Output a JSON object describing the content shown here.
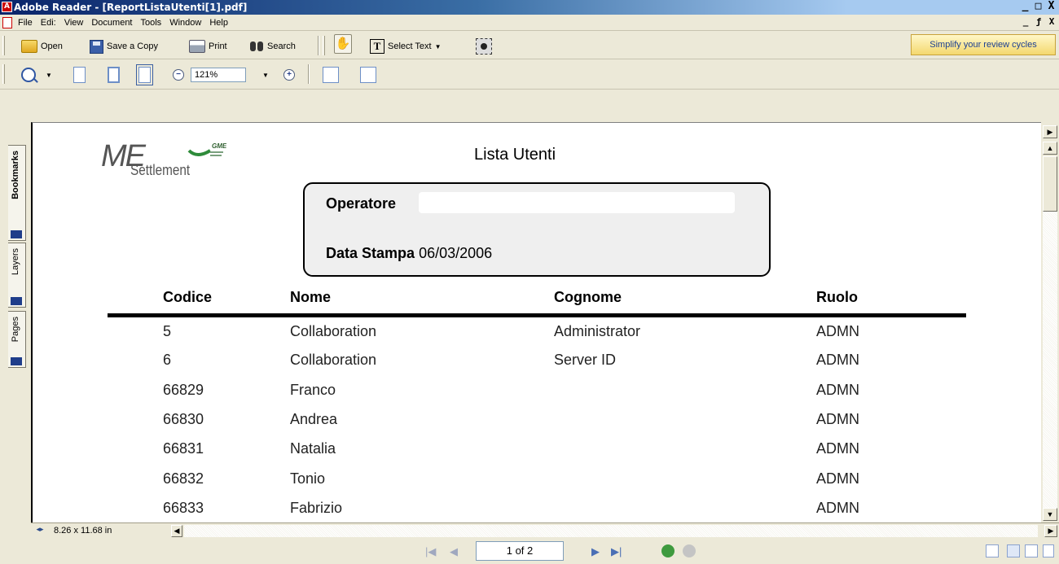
{
  "window": {
    "title": "Adobe Reader - [ReportListaUtenti[1].pdf]",
    "controls": [
      "_",
      "□",
      "X"
    ]
  },
  "menubar": {
    "items": [
      "File",
      "Edi:",
      "View",
      "Document",
      "Tools",
      "Window",
      "Help"
    ],
    "doc_controls": [
      "_",
      "ƒ",
      "X"
    ]
  },
  "toolbar1": {
    "open_label": "Open",
    "save_label": "Save a Copy",
    "print_label": "Print",
    "search_label": "Search",
    "select_text_label": "Select Text",
    "promo_label": "Simplify your review cycles"
  },
  "toolbar2": {
    "zoom_value": "121%",
    "zoom_out_symbol": "−",
    "zoom_in_symbol": "+"
  },
  "navtabs": {
    "bookmarks": "Bookmarks",
    "layers": "Layers",
    "pages": "Pages"
  },
  "document": {
    "logo_me": "ME",
    "logo_settlement": "Settlement",
    "logo_gme": "GME",
    "title": "Lista Utenti",
    "operatore_label": "Operatore",
    "data_stampa_label": "Data Stampa",
    "data_stampa_value": "06/03/2006",
    "columns": [
      "Codice",
      "Nome",
      "Cognome",
      "Ruolo"
    ],
    "rows": [
      {
        "codice": "5",
        "nome": "Collaboration",
        "cognome": "Administrator",
        "ruolo": "ADMN"
      },
      {
        "codice": "6",
        "nome": "Collaboration",
        "cognome": "Server ID",
        "ruolo": "ADMN"
      },
      {
        "codice": "66829",
        "nome": "Franco",
        "cognome": "",
        "ruolo": "ADMN"
      },
      {
        "codice": "66830",
        "nome": "Andrea",
        "cognome": "",
        "ruolo": "ADMN"
      },
      {
        "codice": "66831",
        "nome": "Natalia",
        "cognome": "",
        "ruolo": "ADMN"
      },
      {
        "codice": "66832",
        "nome": "Tonio",
        "cognome": "",
        "ruolo": "ADMN"
      },
      {
        "codice": "66833",
        "nome": "Fabrizio",
        "cognome": "",
        "ruolo": "ADMN"
      }
    ]
  },
  "status": {
    "page_size": "8.26 x 11.68 in",
    "page_indicator": "1 of 2"
  },
  "colors": {
    "titlebar_start": "#0a246a",
    "titlebar_end": "#a6caf0",
    "chrome": "#ece9d8",
    "promo_text": "#1c3f92"
  }
}
